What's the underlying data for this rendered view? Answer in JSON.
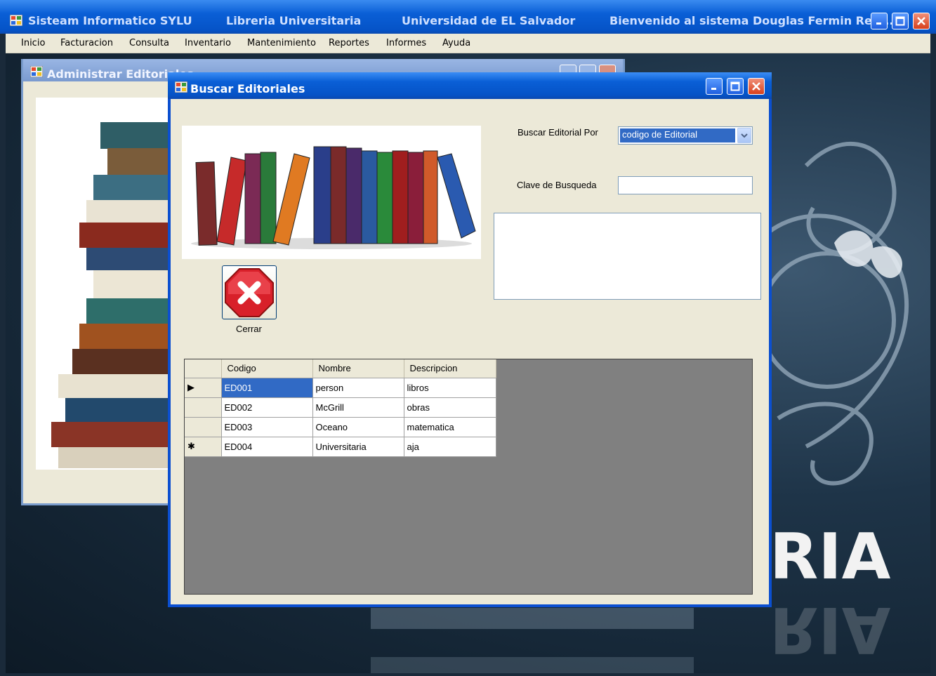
{
  "main_window": {
    "app_name": "Sisteam Informatico SYLU",
    "library": "Libreria Universitaria",
    "university": "Universidad de EL Salvador",
    "welcome": "Bienvenido al sistema Douglas Fermin Reta..."
  },
  "menu": [
    "Inicio",
    "Facturacion",
    "Consulta",
    "Inventario",
    "Mantenimiento",
    "Reportes",
    "Informes",
    "Ayuda"
  ],
  "admin_window": {
    "title": "Administrar Editoriales"
  },
  "background_text": "RIA",
  "dialog": {
    "title": "Buscar Editoriales",
    "search_by_label": "Buscar Editorial Por",
    "search_by_value": "codigo de Editorial",
    "key_label": "Clave de Busqueda",
    "key_value": "",
    "close_label": "Cerrar"
  },
  "grid": {
    "columns": [
      "Codigo",
      "Nombre",
      "Descripcion"
    ],
    "rows": [
      {
        "marker": "▶",
        "codigo": "ED001",
        "nombre": "person",
        "descripcion": "libros"
      },
      {
        "marker": "",
        "codigo": "ED002",
        "nombre": "McGrill",
        "descripcion": "obras"
      },
      {
        "marker": "",
        "codigo": "ED003",
        "nombre": "Oceano",
        "descripcion": "matematica"
      },
      {
        "marker": "✱",
        "codigo": "ED004",
        "nombre": "Universitaria",
        "descripcion": "aja"
      }
    ]
  },
  "colors": {
    "titlebar": "#0553c7",
    "selection": "#316ac5",
    "window_bg": "#ece9d8",
    "grid_bg": "#808080"
  }
}
